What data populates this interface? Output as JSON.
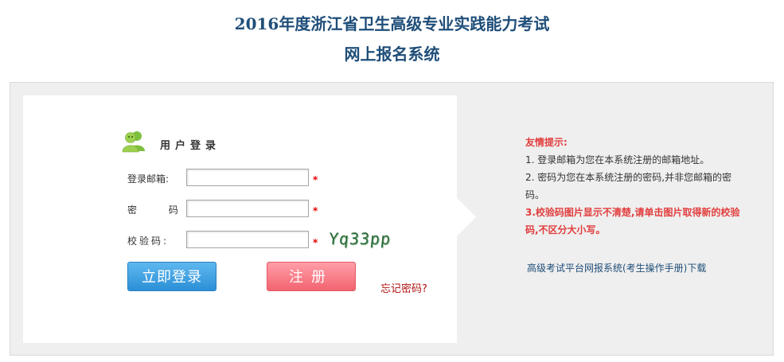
{
  "header": {
    "title_line1": "2016年度浙江省卫生高级专业实践能力考试",
    "title_line2": "网上报名系统"
  },
  "login": {
    "section_title": "用户登录",
    "email_label": "登录邮箱:",
    "password_label": "密 码:",
    "captcha_label": "校验码:",
    "required_mark": "*",
    "captcha_text": "Yq33pp",
    "email_value": "",
    "password_value": "",
    "captcha_value": "",
    "login_button": "立即登录",
    "register_button": "注册",
    "forgot_link": "忘记密码?"
  },
  "tips": {
    "title": "友情提示:",
    "item1": "1.  登录邮箱为您在本系统注册的邮箱地址。",
    "item2": "2.  密码为您在本系统注册的密码,并非您邮箱的密码。",
    "item3": "3.校验码图片显示不清楚,请单击图片取得新的校验码,不区分大小写。",
    "manual_link": "高级考试平台网报系统(考生操作手册)下载"
  },
  "icons": {
    "user": "user-group-icon"
  },
  "colors": {
    "title": "#1f4e79",
    "tip_red": "#e23d3d",
    "login_button": "#2b8fd6",
    "register_button": "#f26470",
    "panel_bg": "#efefef"
  }
}
